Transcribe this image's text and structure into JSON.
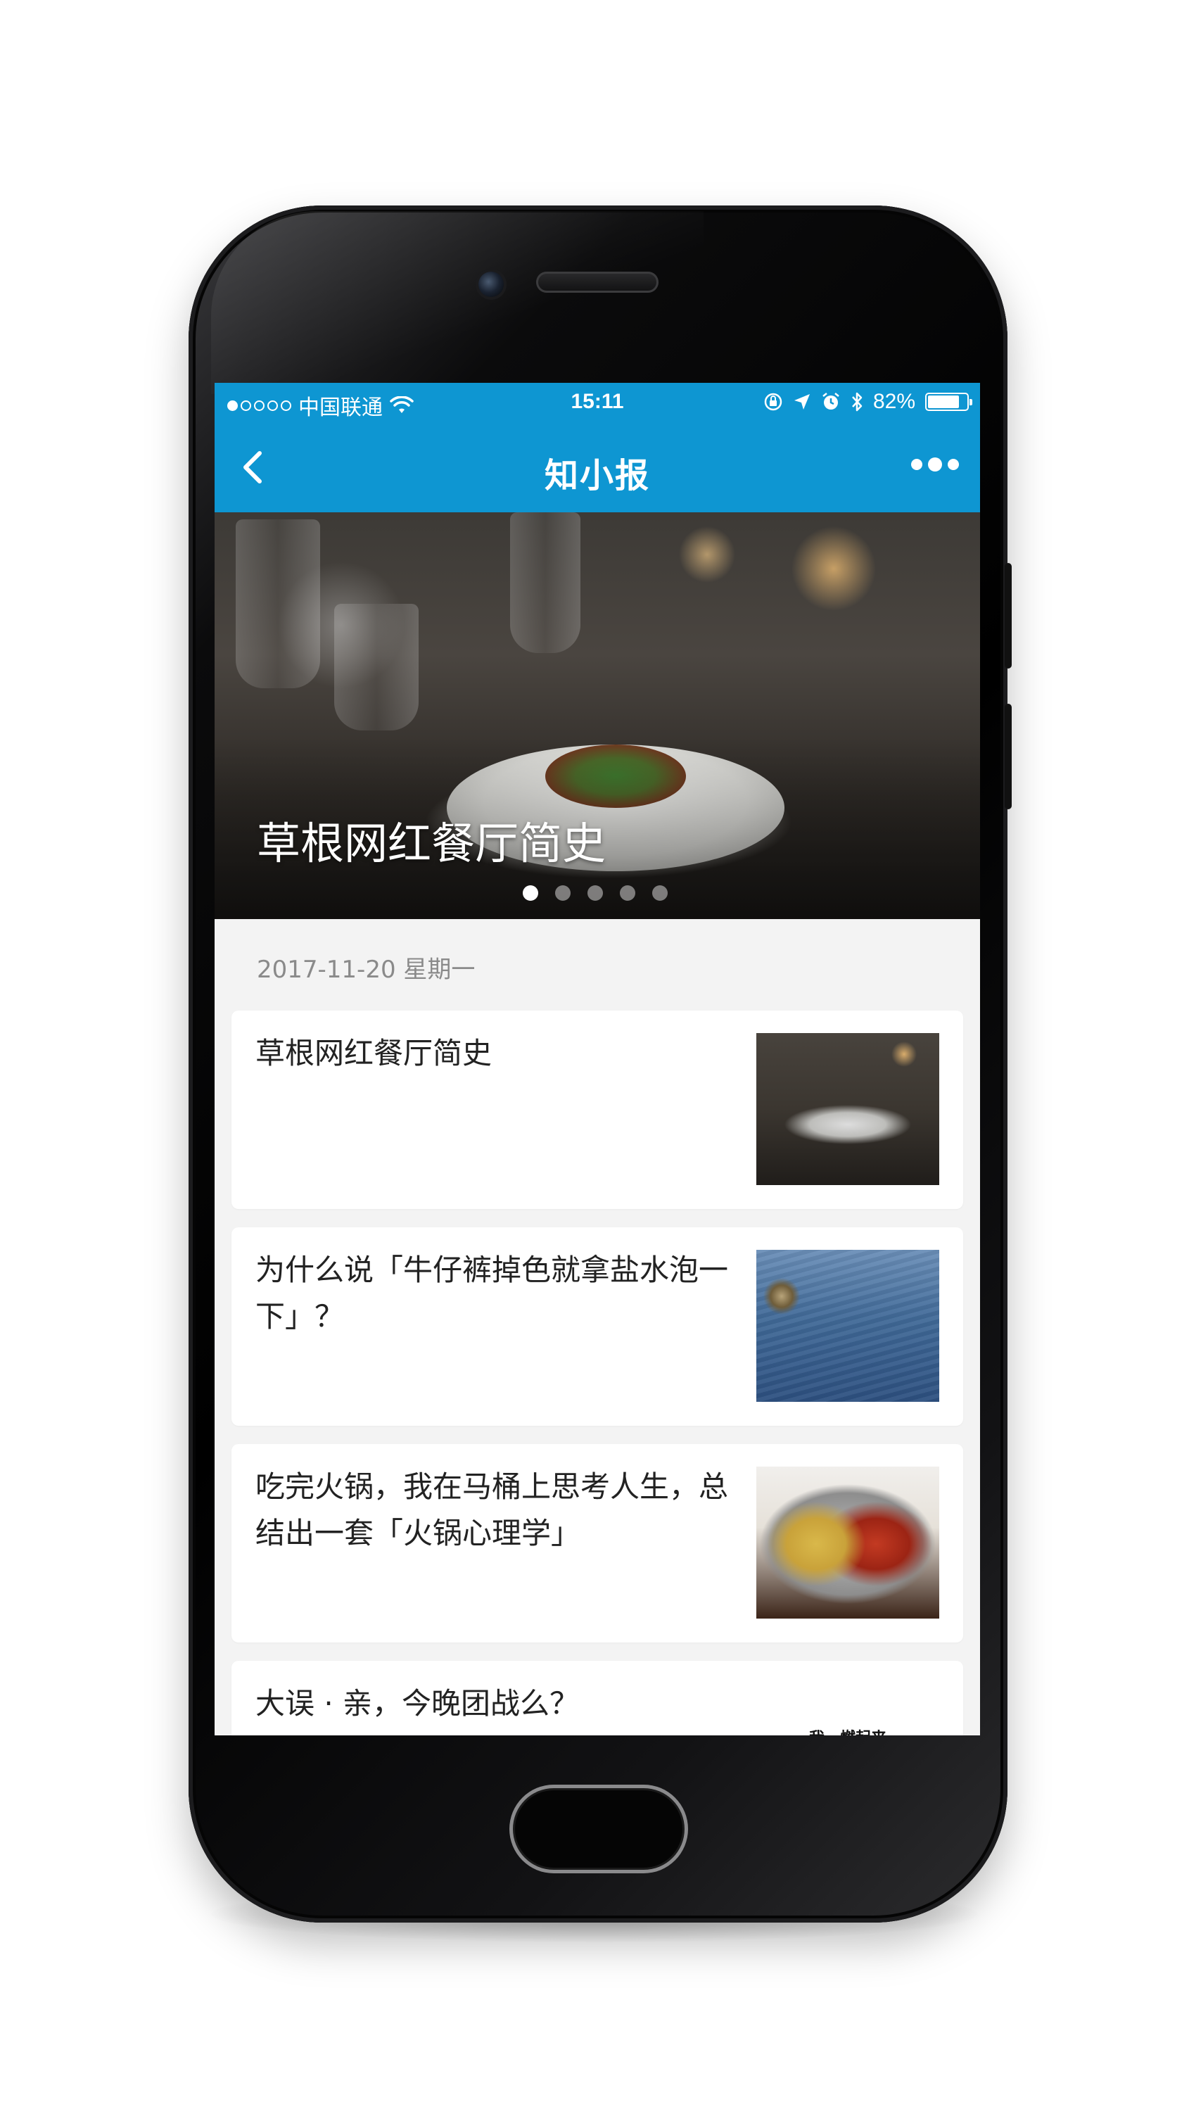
{
  "status_bar": {
    "carrier": "中国联通",
    "time": "15:11",
    "battery_percent": "82%",
    "battery_level": 0.82,
    "signal_dots_on": 1,
    "signal_dots_total": 5,
    "icons": [
      "wifi-icon",
      "rotation-lock-icon",
      "location-icon",
      "alarm-icon",
      "bluetooth-icon",
      "battery-icon"
    ]
  },
  "nav": {
    "back_icon": "chevron-left-icon",
    "title": "知小报",
    "more_icon": "more-dots-icon"
  },
  "hero": {
    "title": "草根网红餐厅简史",
    "slide_count": 5,
    "active_slide": 1
  },
  "date": "2017-11-20 星期一",
  "articles": [
    {
      "title": "草根网红餐厅简史",
      "thumbnail": "restaurant-photo"
    },
    {
      "title": "为什么说「牛仔裤掉色就拿盐水泡一下」？",
      "thumbnail": "jeans-photo"
    },
    {
      "title": "吃完火锅，我在马桶上思考人生，总结出一套「火锅心理学」",
      "thumbnail": "hotpot-photo"
    },
    {
      "title": "大误 · 亲，今晚团战么？",
      "thumbnail": "game-image",
      "thumbnail_text": "我一燃起来"
    }
  ],
  "colors": {
    "accent": "#0e96d2",
    "background": "#f3f3f3",
    "card": "#ffffff",
    "date_text": "#8a8a8a"
  }
}
